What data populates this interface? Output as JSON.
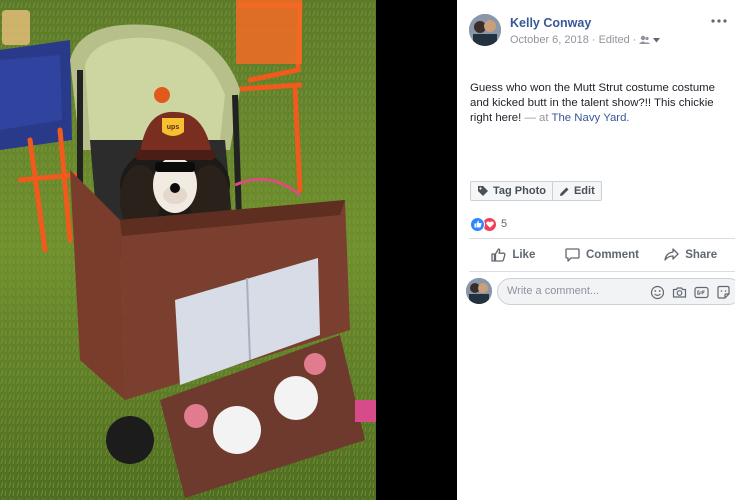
{
  "post": {
    "author": "Kelly Conway",
    "date": "October 6, 2018",
    "edited": "Edited",
    "dot": "·",
    "text": "Guess who won the Mutt Strut costume costume and kicked butt in the talent show?!! This chickie right here!",
    "at_separator": "— at",
    "place": "The Navy Yard."
  },
  "photo_actions": {
    "tag_photo": "Tag Photo",
    "edit": "Edit"
  },
  "reactions": {
    "count": "5",
    "types": [
      "like-icon",
      "love-icon"
    ]
  },
  "actions": {
    "like": "Like",
    "comment": "Comment",
    "share": "Share"
  },
  "comment_box": {
    "placeholder": "Write a comment...",
    "icons": [
      "emoji-icon",
      "camera-icon",
      "gif-icon",
      "sticker-icon"
    ]
  },
  "photo": {
    "box_logo_text": "ups"
  },
  "colors": {
    "link": "#385898",
    "meta": "#90949c",
    "like_blue": "#2d88ff",
    "love_red": "#f33e58"
  }
}
